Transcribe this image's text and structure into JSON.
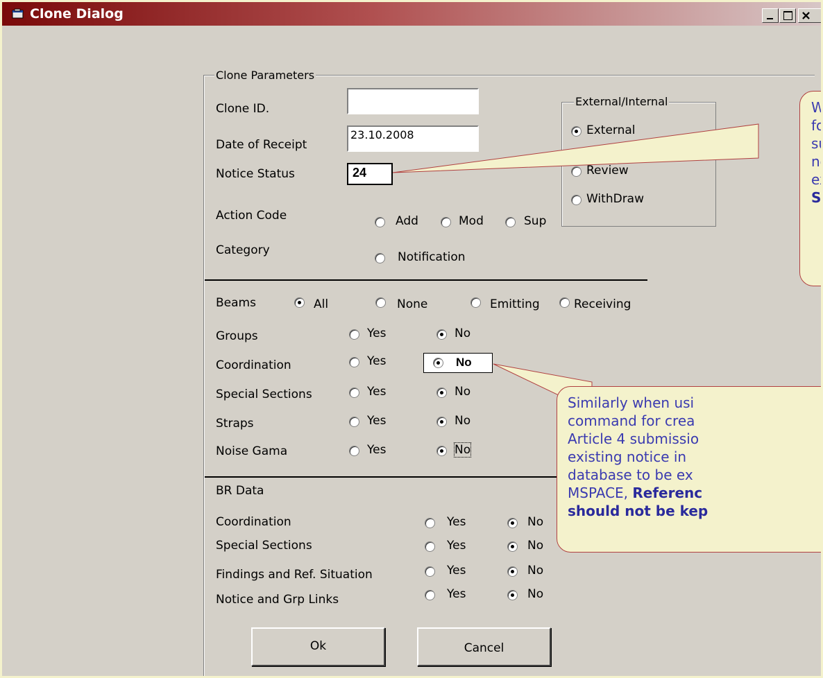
{
  "window": {
    "title": "Clone Dialog",
    "buttons": {
      "minimize": "_",
      "maximize": "□",
      "close": "×"
    }
  },
  "clone_params": {
    "group_label": "Clone Parameters",
    "clone_id_label": "Clone ID.",
    "clone_id_value": "",
    "date_label": "Date of Receipt",
    "date_value": "23.10.2008",
    "notice_status_label": "Notice Status",
    "notice_status_value": "24",
    "action_code_label": "Action Code",
    "action_add": "Add",
    "action_mod": "Mod",
    "action_sup": "Sup",
    "category_label": "Category",
    "category_notification": "Notification"
  },
  "ext_int": {
    "group_label": "External/Internal",
    "external": "External",
    "review": "Review",
    "withdraw": "WithDraw"
  },
  "beams": {
    "label": "Beams",
    "all": "All",
    "none": "None",
    "emitting": "Emitting",
    "receiving": "Receiving"
  },
  "options": {
    "groups": "Groups",
    "coordination": "Coordination",
    "special_sections": "Special Sections",
    "straps": "Straps",
    "noise_gama": "Noise Gama",
    "yes": "Yes",
    "no": "No"
  },
  "br_data": {
    "label": "BR Data",
    "coordination": "Coordination",
    "special_sections": "Special Sections",
    "findings": "Findings and Ref. Situation",
    "notice_links": "Notice and Grp Links",
    "yes": "Yes",
    "no": "No"
  },
  "actions": {
    "ok": "Ok",
    "cancel": "Cancel"
  },
  "callout1": {
    "line1": "Wh",
    "line2": "for",
    "line3": "sub",
    "line4": "not",
    "line5": "exa",
    "line6": "Sta"
  },
  "callout2": {
    "line1": "Similarly when usi",
    "line2": "command for crea",
    "line3": "Article 4 submissio",
    "line4": "existing notice in",
    "line5": "database to be ex",
    "line6_plain": "MSPACE, ",
    "line6_bold": "Referenc",
    "line7": "should not be kep"
  },
  "colors": {
    "background": "#f4f2cc",
    "dialog": "#d4d0c8",
    "title_bar_start": "#7a0a0a",
    "callout_text": "#3a3ab0"
  }
}
